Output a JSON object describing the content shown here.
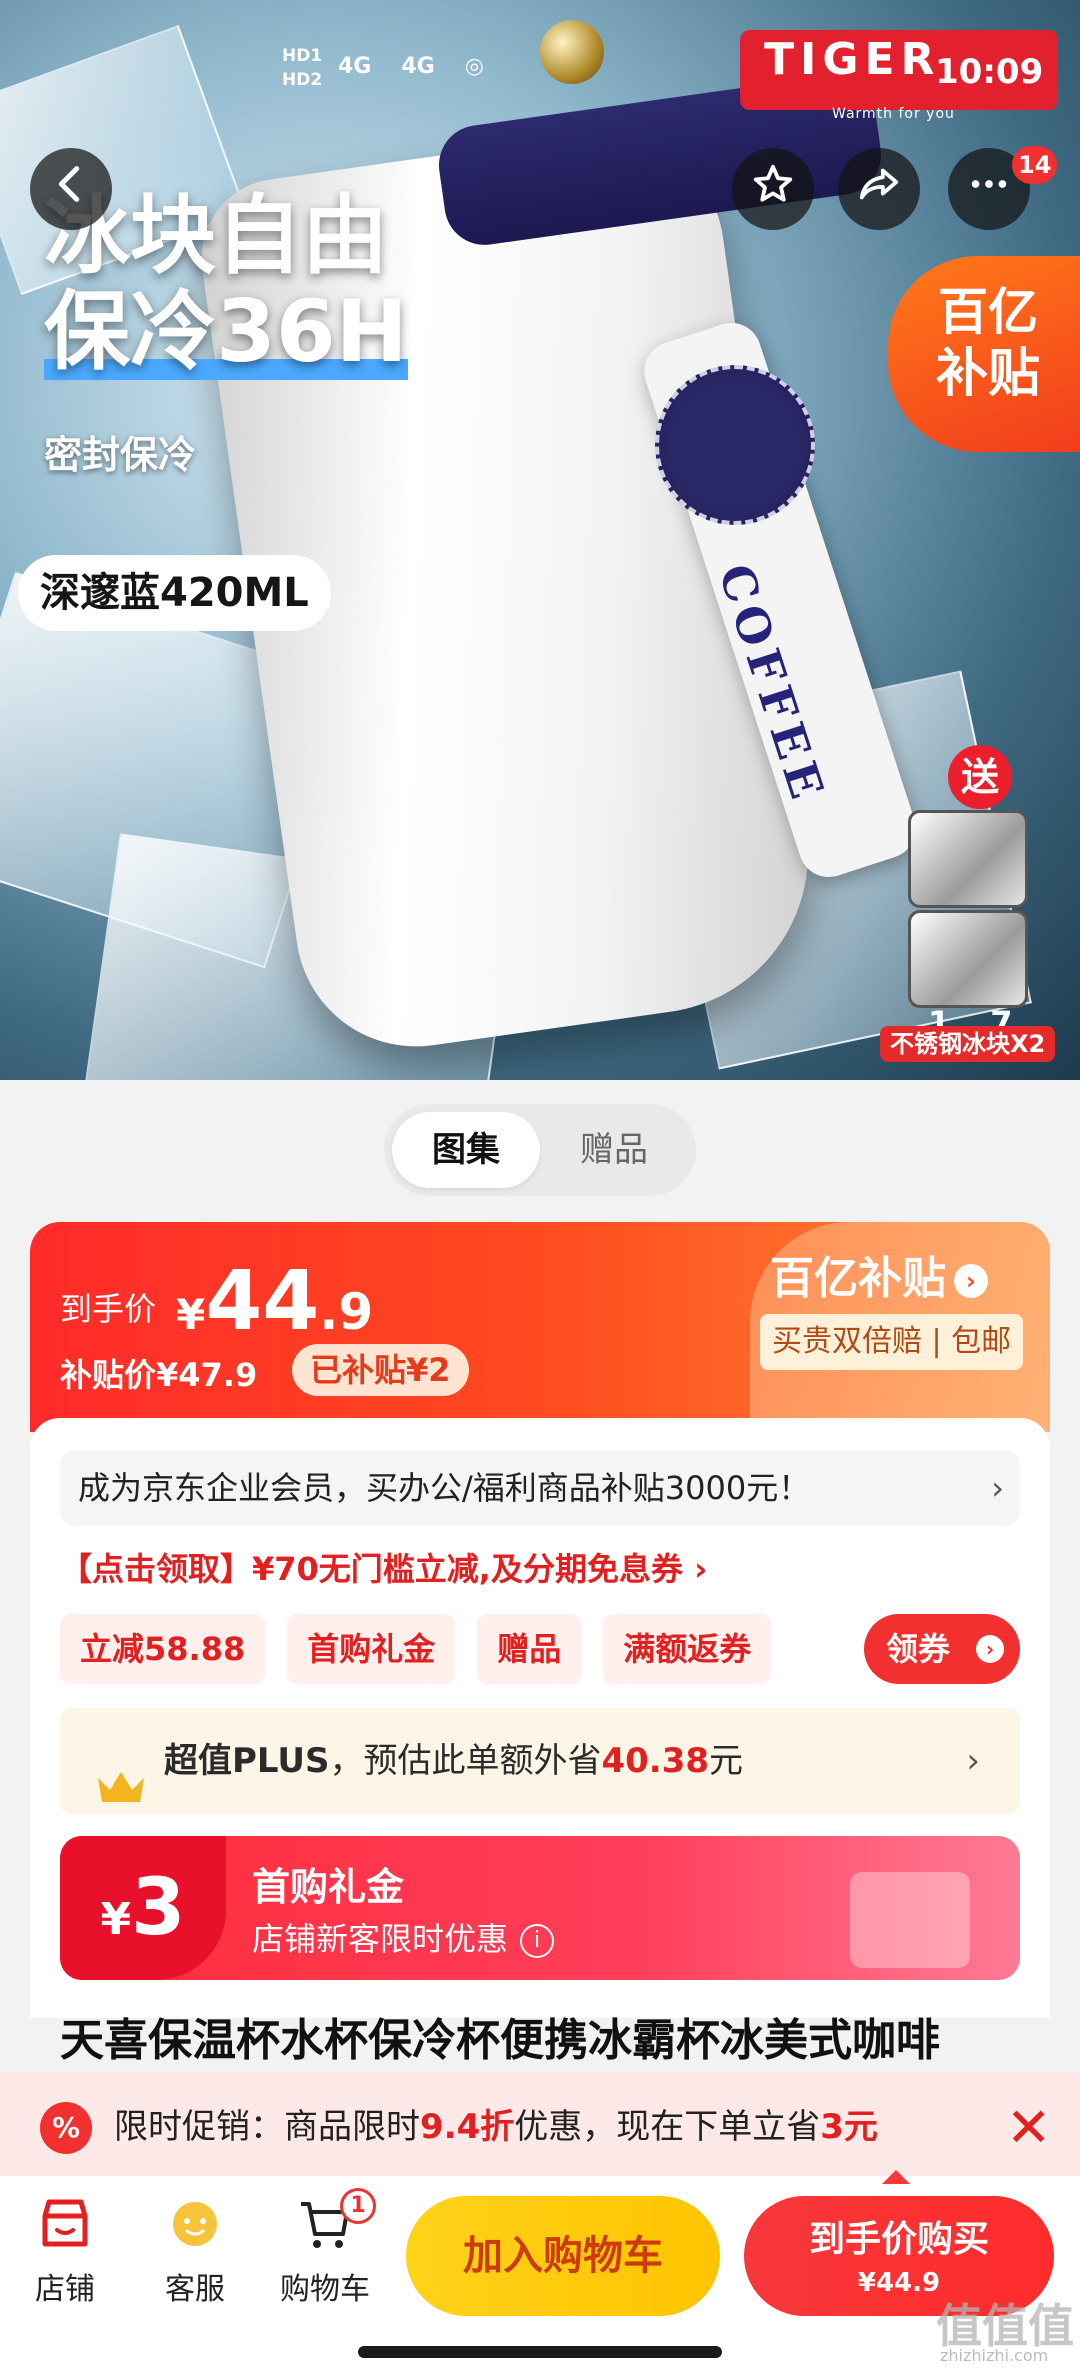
{
  "status": {
    "hd1": "HD1",
    "hd2": "HD2",
    "net1": "4G",
    "net2": "4G",
    "time": "10:09"
  },
  "hero": {
    "title_line1": "冰块自由",
    "title_line2": "保冷36H",
    "subtitle": "密封保冷",
    "capacity": "深邃蓝420ML",
    "brand_logo": "TIGER",
    "brand_slogan": "Warmth for you",
    "strap_text": "COFFEE",
    "subsidy_line1": "百亿",
    "subsidy_line2": "补贴",
    "gift_tag": "送",
    "gift_label": "不锈钢冰块X2",
    "pager": "17",
    "message_count": "14"
  },
  "tabs": [
    {
      "label": "图集",
      "active": true
    },
    {
      "label": "赠品",
      "active": false
    }
  ],
  "price": {
    "final_label": "到手价",
    "currency": "¥",
    "final_int": "44",
    "final_dec": ".9",
    "subsidy_label": "补贴价¥47.9",
    "subsidized": "已补贴¥2",
    "brand": "百亿补贴",
    "guarantee": "买贵双倍赔 | 包邮"
  },
  "promo": {
    "enterprise": "成为京东企业会员，买办公/福利商品补贴3000元！",
    "enterprise_chev": "›",
    "coupon_link": "【点击领取】¥70无门槛立减,及分期免息券 ›",
    "tags": [
      "立减58.88",
      "首购礼金",
      "赠品",
      "满额返券"
    ],
    "get_coupon": "领券"
  },
  "plus": {
    "brand": "超值PLUS",
    "text": "，预估此单额外省",
    "amount": "40.38",
    "unit": "元",
    "chev": "›"
  },
  "first_gift": {
    "yen": "¥",
    "amount": "3",
    "title": "首购礼金",
    "desc": "店铺新客限时优惠",
    "info": "i"
  },
  "product_title": "天喜保温杯水杯保冷杯便携冰霸杯冰美式咖啡",
  "limit_bar": {
    "icon": "%",
    "prefix": "限时促销：商品限时",
    "discount": "9.4折",
    "middle": "优惠，现在下单立省",
    "save": "3元",
    "close": "✕"
  },
  "bottom": {
    "store": "店铺",
    "service": "客服",
    "cart": "购物车",
    "cart_count": "1",
    "add_to_cart": "加入购物车",
    "buy_now": "到手价购买",
    "buy_price": "¥44.9"
  },
  "watermark": {
    "main": "值值值",
    "sub": "zhizhizhi.com"
  },
  "colors": {
    "accent_red": "#f23030",
    "subsidy_orange": "#ff4a1f",
    "cart_yellow": "#ffd21a"
  }
}
